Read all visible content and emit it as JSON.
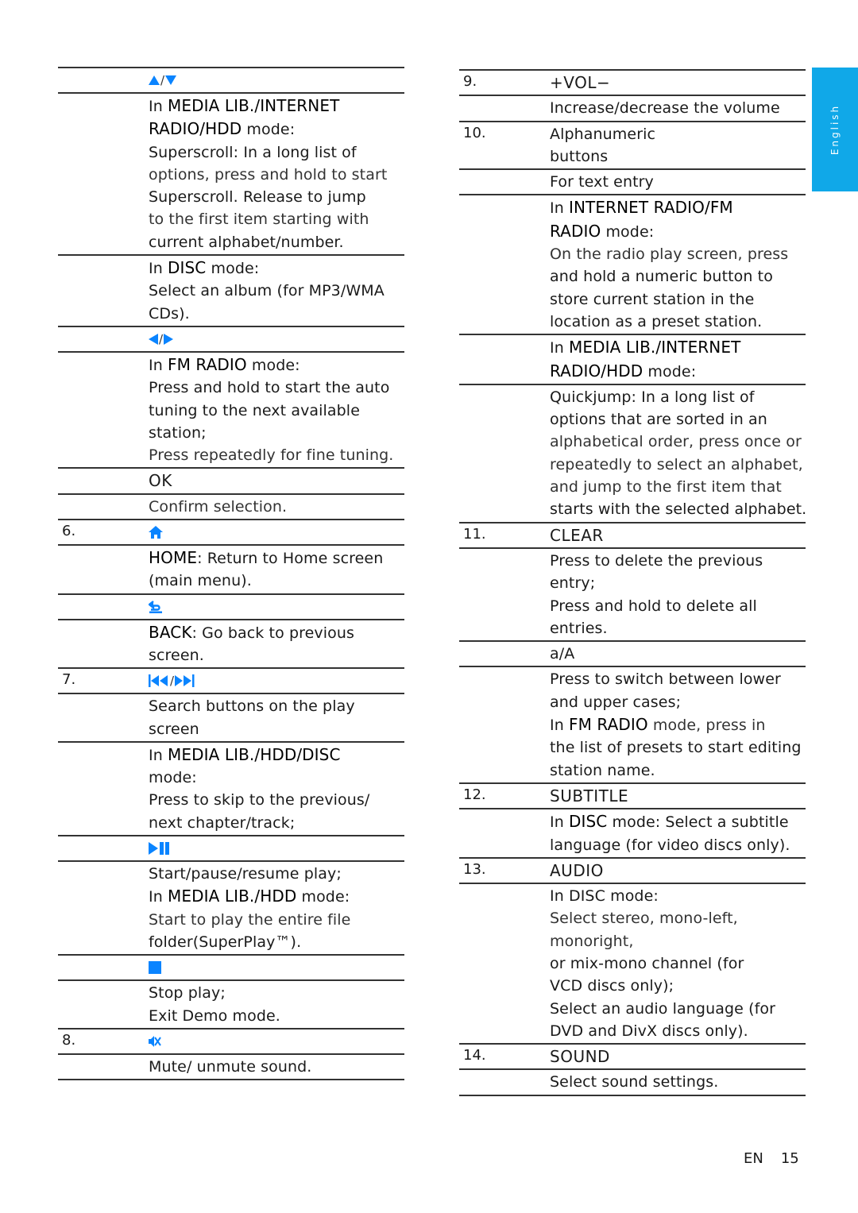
{
  "language_tab": "English",
  "footer": {
    "lang": "EN",
    "page": "15"
  },
  "colors": {
    "icon_blue": "#0a84ff",
    "tab_blue": "#10a8e8",
    "rule": "#333333"
  },
  "left": {
    "up_down": {
      "icon": "up-down-arrows",
      "mode_prefix": "In ",
      "mode_kw": "MEDIA LIB./INTERNET",
      "mode_kw2": "RADIO/HDD",
      "mode_suffix": " mode:",
      "lines": [
        "Superscroll: In a long list of",
        "options, press and hold to start",
        "Superscroll. Release to jump",
        "to the first item starting with",
        "current alphabet/number."
      ],
      "disc_prefix": "In ",
      "disc_kw": "DISC",
      "disc_suffix": " mode:",
      "disc_lines": [
        "Select an album (for MP3/WMA",
        "CDs)."
      ]
    },
    "left_right": {
      "icon": "left-right-arrows",
      "mode_prefix": "In ",
      "mode_kw": "FM RADIO",
      "mode_suffix": " mode:",
      "lines": [
        "Press and hold to start the auto",
        "tuning to the next available",
        "station;",
        "Press repeatedly for fine tuning."
      ]
    },
    "ok": {
      "title": "OK",
      "desc": "Confirm selection."
    },
    "home": {
      "num": "6.",
      "icon": "home",
      "kw": "HOME",
      "desc1": ": Return to Home screen",
      "desc2": "(main menu)."
    },
    "back": {
      "icon": "back",
      "kw": "BACK",
      "desc1": ": Go back to previous",
      "desc2": "screen."
    },
    "skip": {
      "num": "7.",
      "icon": "previous-next",
      "lines": [
        "Search buttons on the play",
        "screen"
      ],
      "mode_prefix": "In ",
      "mode_kw": "MEDIA LIB./HDD/DISC",
      "mode_suffix": "mode:",
      "mode_lines": [
        "Press to skip to the previous/",
        "next chapter/track;"
      ]
    },
    "play_pause": {
      "icon": "play-pause",
      "line1": "Start/pause/resume play;",
      "mode_prefix": "In ",
      "mode_kw": "MEDIA LIB./HDD",
      "mode_suffix": " mode:",
      "line3": "Start to play the entire file",
      "line4": "folder(SuperPlay™)."
    },
    "stop": {
      "icon": "stop",
      "lines": [
        "Stop play;",
        "Exit Demo mode."
      ]
    },
    "mute": {
      "num": "8.",
      "icon": "mute",
      "desc": "Mute/ unmute sound."
    }
  },
  "right": {
    "vol": {
      "num": "9.",
      "title": "+VOL−",
      "desc": "Increase/decrease the volume"
    },
    "alnum": {
      "num": "10.",
      "title1": "Alphanumeric",
      "title2": "buttons",
      "desc": "For text entry",
      "radio_prefix": "In ",
      "radio_kw": "INTERNET RADIO/FM",
      "radio_kw2": "RADIO",
      "radio_suffix": " mode:",
      "radio_lines": [
        "On the radio play screen, press",
        "and hold a numeric button to",
        "store current station in the",
        "location as a preset station."
      ],
      "media_prefix": "In ",
      "media_kw": "MEDIA LIB./INTERNET",
      "media_kw2": "RADIO/HDD",
      "media_suffix": " mode:",
      "quick_lines": [
        "Quickjump: In a long list of",
        "options that are sorted in an",
        "alphabetical order, press once or",
        "repeatedly to select an alphabet,",
        "and jump to the first item that",
        "starts with the selected alphabet."
      ]
    },
    "clear": {
      "num": "11.",
      "title": "CLEAR",
      "lines": [
        "Press to delete the previous",
        "entry;",
        "Press and hold to delete all",
        "entries."
      ]
    },
    "case": {
      "title": "a/A",
      "lines": [
        "Press to switch between lower",
        "and upper cases;"
      ],
      "fm_prefix": "In ",
      "fm_kw": "FM RADIO",
      "fm_suffix": " mode, press in",
      "fm_lines": [
        "the list of presets to start editing",
        "station name."
      ]
    },
    "subtitle": {
      "num": "12.",
      "title": "SUBTITLE",
      "prefix": "In ",
      "kw": "DISC",
      "suffix": " mode: Select a subtitle",
      "line2": "language (for video discs only)."
    },
    "audio": {
      "num": "13.",
      "title": "AUDIO",
      "lines": [
        "In DISC mode:",
        "Select stereo, mono-left,",
        "monoright,",
        "or mix-mono channel (for",
        "VCD discs only);",
        "Select an audio language (for",
        "DVD and DivX discs only)."
      ]
    },
    "sound": {
      "num": "14.",
      "title": "SOUND",
      "desc": "Select sound settings."
    }
  }
}
